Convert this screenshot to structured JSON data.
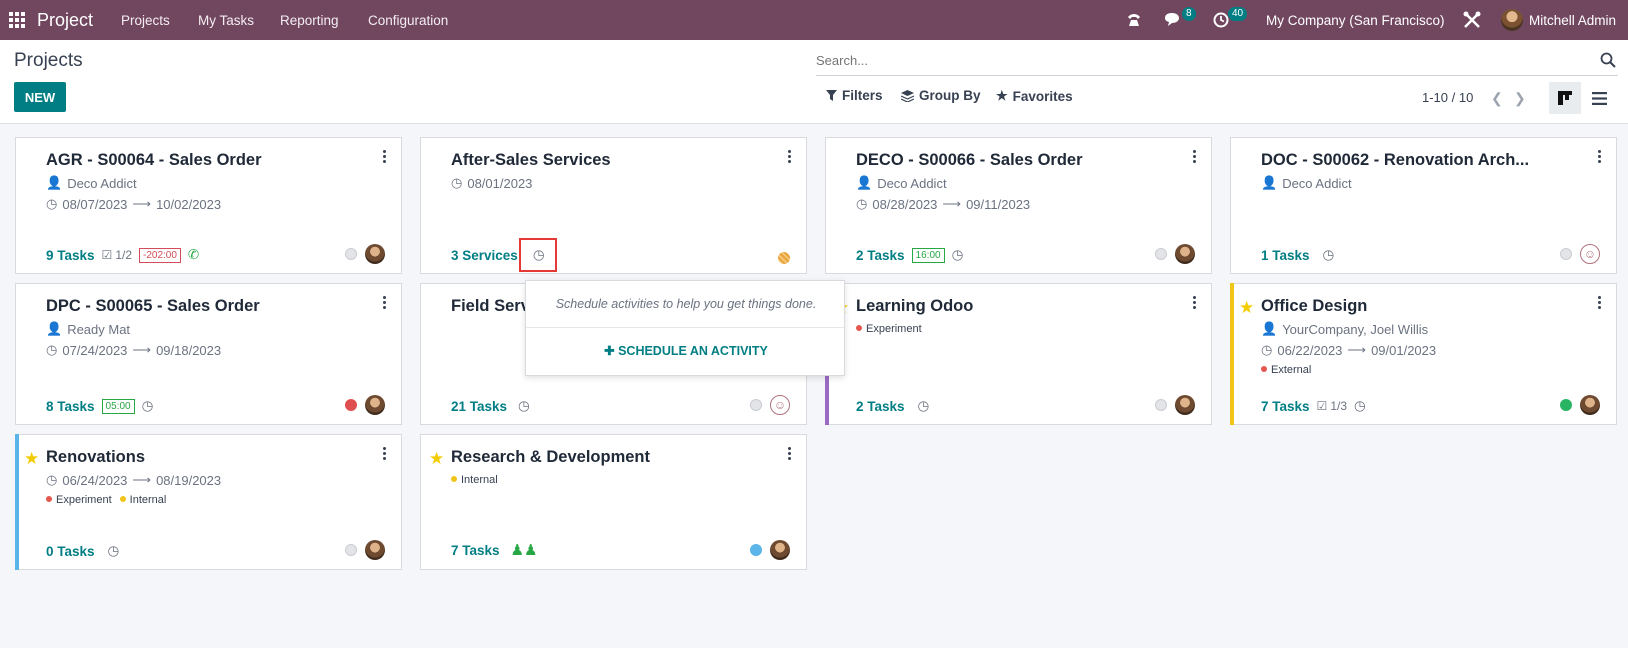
{
  "navbar": {
    "brand": "Project",
    "menus": [
      "Projects",
      "My Tasks",
      "Reporting",
      "Configuration"
    ],
    "messages_count": "8",
    "activities_count": "40",
    "company": "My Company (San Francisco)",
    "user": "Mitchell Admin"
  },
  "control": {
    "title": "Projects",
    "new_label": "NEW",
    "search_placeholder": "Search...",
    "filters_label": "Filters",
    "groupby_label": "Group By",
    "favorites_label": "Favorites",
    "pager": "1-10 / 10"
  },
  "cards": {
    "agr": {
      "title": "AGR - S00064 - Sales Order",
      "customer": "Deco Addict",
      "start": "08/07/2023",
      "end": "10/02/2023",
      "count": "9 Tasks",
      "checklist": "1/2",
      "badge": "-202:00"
    },
    "after": {
      "title": "After-Sales Services",
      "date": "08/01/2023",
      "count": "3 Services"
    },
    "deco": {
      "title": "DECO - S00066 - Sales Order",
      "customer": "Deco Addict",
      "start": "08/28/2023",
      "end": "09/11/2023",
      "count": "2 Tasks",
      "badge": "16:00"
    },
    "doc": {
      "title": "DOC - S00062 - Renovation Arch...",
      "customer": "Deco Addict",
      "count": "1 Tasks"
    },
    "dpc": {
      "title": "DPC - S00065 - Sales Order",
      "customer": "Ready Mat",
      "start": "07/24/2023",
      "end": "09/18/2023",
      "count": "8 Tasks",
      "badge": "05:00"
    },
    "field": {
      "title": "Field Serv",
      "count": "21 Tasks"
    },
    "learning": {
      "title": "Learning Odoo",
      "tag": "Experiment",
      "count": "2 Tasks"
    },
    "office": {
      "title": "Office Design",
      "customer": "YourCompany, Joel Willis",
      "start": "06/22/2023",
      "end": "09/01/2023",
      "tag": "External",
      "count": "7 Tasks",
      "checklist": "1/3"
    },
    "renov": {
      "title": "Renovations",
      "start": "06/24/2023",
      "end": "08/19/2023",
      "tag1": "Experiment",
      "tag2": "Internal",
      "count": "0 Tasks"
    },
    "rnd": {
      "title": "Research & Development",
      "tag": "Internal",
      "count": "7 Tasks"
    }
  },
  "popover": {
    "hint": "Schedule activities to help you get things done.",
    "action": "SCHEDULE AN ACTIVITY"
  },
  "colors": {
    "navbar": "#71475f",
    "accent": "#017e84",
    "highlight": "#e53935"
  }
}
